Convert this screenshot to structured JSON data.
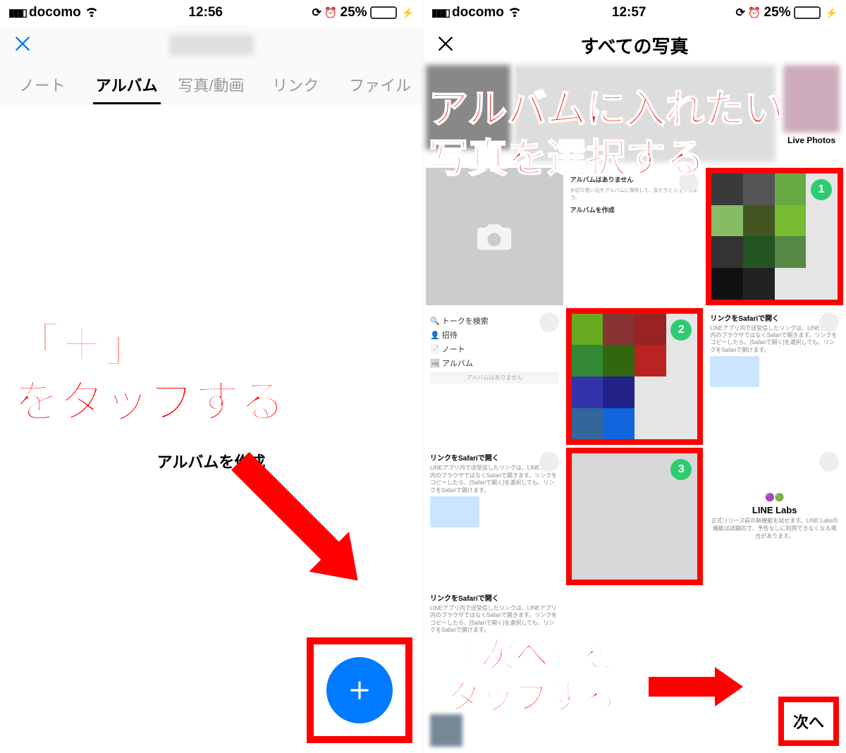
{
  "status": {
    "carrier": "docomo",
    "time_left": "12:56",
    "time_right": "12:57",
    "battery_pct": "25%"
  },
  "left_screen": {
    "tabs": [
      "ノート",
      "アルバム",
      "写真/動画",
      "リンク",
      "ファイル"
    ],
    "active_tab": "アルバム",
    "empty_label": "アルバムを作成"
  },
  "right_screen": {
    "title": "すべての写真",
    "live_photos_label": "Live Photos",
    "selection_badges": [
      "1",
      "2",
      "3"
    ],
    "menu_placeholder": {
      "no_album_title": "アルバムはありません",
      "no_album_sub": "大切な思い出をアルバムに保存して、友だちとシェアしよう。",
      "create_label": "アルバムを作成",
      "items": [
        "トークを検索",
        "招待",
        "ノート",
        "アルバム"
      ],
      "items_footer": "アルバムはありません"
    },
    "safari_tile": {
      "title": "リンクをSafariで開く",
      "body": "LINEアプリ内で送受信したリンクは、LINEアプリ内のブラウザではなくSafariで開きます。リンクをコピーしたら、[Safariで開く]を選択しても、リンクをSafariで開けます。"
    },
    "labs_tile": {
      "title": "LINE Labs",
      "desc": "正式リリース前の新機能を試せます。LINE Labsの機能は試験的で、予告なしに利用できなくなる場合があります。"
    },
    "next_label": "次へ"
  },
  "annotations": {
    "left": "「＋」\nをタップする",
    "right_top": "アルバムに入れたい\n写真を選択する",
    "right_bottom": "「次へ」を\nタップする"
  }
}
